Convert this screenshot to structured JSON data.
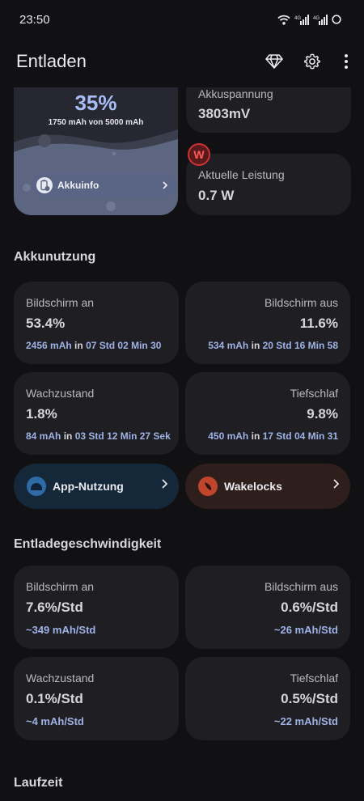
{
  "status_bar": {
    "time": "23:50"
  },
  "app_bar": {
    "title": "Entladen"
  },
  "battery": {
    "percent": "35%",
    "capacity_text": "1750 mAh von 5000 mAh",
    "level": 0.35,
    "info_button": "Akkuinfo"
  },
  "voltage": {
    "label": "Akkuspannung",
    "value": "3803mV"
  },
  "power": {
    "label": "Aktuelle Leistung",
    "value": "0.7 W",
    "badge": "W"
  },
  "usage": {
    "title": "Akkunutzung",
    "screen_on": {
      "label": "Bildschirm an",
      "value": "53.4%",
      "mah": "2456 mAh",
      "in": "in",
      "duration": "07 Std 02 Min 30"
    },
    "screen_off": {
      "label": "Bildschirm aus",
      "value": "11.6%",
      "mah": "534 mAh",
      "in": "in",
      "duration": "20 Std 16 Min 58"
    },
    "awake": {
      "label": "Wachzustand",
      "value": "1.8%",
      "mah": "84 mAh",
      "in": "in",
      "duration": "03 Std 12 Min 27 Sek"
    },
    "deep_sleep": {
      "label": "Tiefschlaf",
      "value": "9.8%",
      "mah": "450 mAh",
      "in": "in",
      "duration": "17 Std 04 Min 31"
    },
    "app_usage_button": "App-Nutzung",
    "wakelocks_button": "Wakelocks"
  },
  "discharge_speed": {
    "title": "Entladegeschwindigkeit",
    "screen_on": {
      "label": "Bildschirm an",
      "value": "7.6%/Std",
      "sub": "~349 mAh/Std"
    },
    "screen_off": {
      "label": "Bildschirm aus",
      "value": "0.6%/Std",
      "sub": "~26 mAh/Std"
    },
    "awake": {
      "label": "Wachzustand",
      "value": "0.1%/Std",
      "sub": "~4 mAh/Std"
    },
    "deep_sleep": {
      "label": "Tiefschlaf",
      "value": "0.5%/Std",
      "sub": "~22 mAh/Std"
    }
  },
  "runtime": {
    "title": "Laufzeit"
  },
  "colors": {
    "accent": "#a8bdf5",
    "card": "#1f1f23",
    "background": "#111114",
    "app_usage_pill": "#15283a",
    "wakelocks_pill": "#2e1e1c"
  }
}
